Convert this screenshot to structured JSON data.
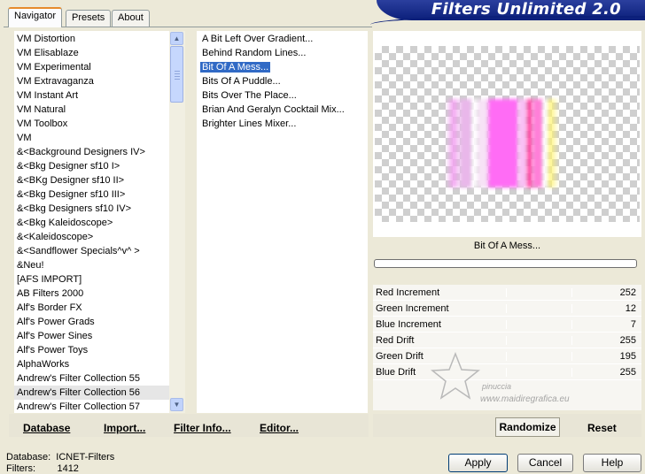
{
  "tabs": [
    "Navigator",
    "Presets",
    "About"
  ],
  "banner_title": "Filters Unlimited 2.0",
  "categories": [
    "VM Distortion",
    "VM Elisablaze",
    "VM Experimental",
    "VM Extravaganza",
    "VM Instant Art",
    "VM Natural",
    "VM Toolbox",
    "VM",
    "&<Background Designers IV>",
    "&<Bkg Designer sf10 I>",
    "&<BKg Designer sf10 II>",
    "&<Bkg Designer sf10 III>",
    "&<Bkg Designers sf10 IV>",
    "&<Bkg Kaleidoscope>",
    "&<Kaleidoscope>",
    "&<Sandflower Specials^v^ >",
    "&Neu!",
    "[AFS IMPORT]",
    "AB Filters 2000",
    "Alf's Border FX",
    "Alf's Power Grads",
    "Alf's Power Sines",
    "Alf's Power Toys",
    "AlphaWorks",
    "Andrew's Filter Collection 55",
    "Andrew's Filter Collection 56",
    "Andrew's Filter Collection 57"
  ],
  "selected_category": "Andrew's Filter Collection 56",
  "filters": [
    "A Bit Left Over Gradient...",
    "Behind Random Lines...",
    "Bit Of A Mess...",
    "Bits Of A Puddle...",
    "Bits Over The Place...",
    "Brian And Geralyn Cocktail Mix...",
    "Brighter Lines Mixer..."
  ],
  "selected_filter": "Bit Of A Mess...",
  "preview_filter_name": "Bit Of A Mess...",
  "params": [
    {
      "label": "Red Increment",
      "value": "252"
    },
    {
      "label": "Green Increment",
      "value": "12"
    },
    {
      "label": "Blue Increment",
      "value": "7"
    },
    {
      "label": "Red Drift",
      "value": "255"
    },
    {
      "label": "Green Drift",
      "value": "195"
    },
    {
      "label": "Blue Drift",
      "value": "255"
    }
  ],
  "bottom_left_buttons": {
    "database": "Database",
    "import": "Import...",
    "filter_info": "Filter Info...",
    "editor": "Editor..."
  },
  "randomize": "Randomize",
  "reset": "Reset",
  "status": {
    "database_label": "Database:",
    "database_value": "ICNET-Filters",
    "filters_label": "Filters:",
    "filters_value": "1412"
  },
  "dialog_buttons": {
    "apply": "Apply",
    "cancel": "Cancel",
    "help": "Help"
  },
  "watermark": {
    "line1": "pinuccia",
    "line2": "www.maidiregrafica.eu"
  }
}
